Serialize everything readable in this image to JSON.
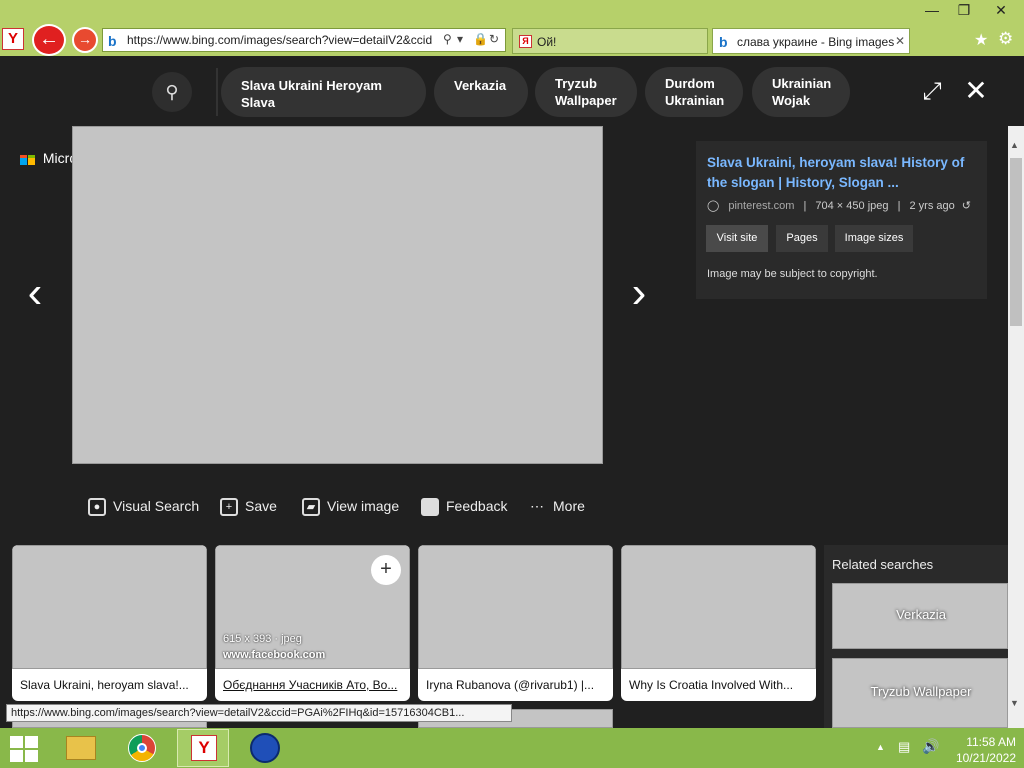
{
  "browser": {
    "address_url": "https://www.bing.com/images/search?view=detailV2&ccid",
    "tabs": [
      {
        "label": "Ой!"
      },
      {
        "label": "слава украине - Bing images"
      }
    ],
    "window_controls": {
      "minimize": "—",
      "restore": "❐",
      "close": "✕"
    }
  },
  "bing": {
    "search_chips": [
      {
        "label": "Slava Ukraini Heroyam Slava"
      },
      {
        "label": "Verkazia"
      },
      {
        "label": "Tryzub Wallpaper"
      },
      {
        "label": "Durdom Ukrainian"
      },
      {
        "label": "Ukrainian Wojak"
      }
    ],
    "logo_text": "Microsoft Bing",
    "info": {
      "title": "Slava Ukraini, heroyam slava! History of the slogan | History, Slogan ...",
      "source": "pinterest.com",
      "dimensions": "704 × 450 jpeg",
      "age": "2 yrs ago",
      "buttons": [
        {
          "label": "Visit site"
        },
        {
          "label": "Pages"
        },
        {
          "label": "Image sizes"
        }
      ],
      "copyright": "Image may be subject to copyright."
    },
    "actions": [
      {
        "label": "Visual Search"
      },
      {
        "label": "Save"
      },
      {
        "label": "View image"
      },
      {
        "label": "Feedback"
      },
      {
        "label": "More"
      }
    ],
    "thumbnails": [
      {
        "caption": "Slava Ukraini, heroyam slava!..."
      },
      {
        "caption": "Обєднання Учасників Ато, Во...",
        "overlay_dims": "615 x 393 · jpeg",
        "overlay_site": "www.facebook.com"
      },
      {
        "caption": "Iryna Rubanova (@rivarub1) |..."
      },
      {
        "caption": "Why Is Croatia Involved With..."
      }
    ],
    "related_searches": {
      "heading": "Related searches",
      "items": [
        {
          "label": "Verkazia"
        },
        {
          "label": "Tryzub Wallpaper"
        }
      ]
    }
  },
  "status_tooltip": "https://www.bing.com/images/search?view=detailV2&ccid=PGAi%2FIHq&id=15716304CB1...",
  "taskbar": {
    "time": "11:58 AM",
    "date": "10/21/2022"
  }
}
